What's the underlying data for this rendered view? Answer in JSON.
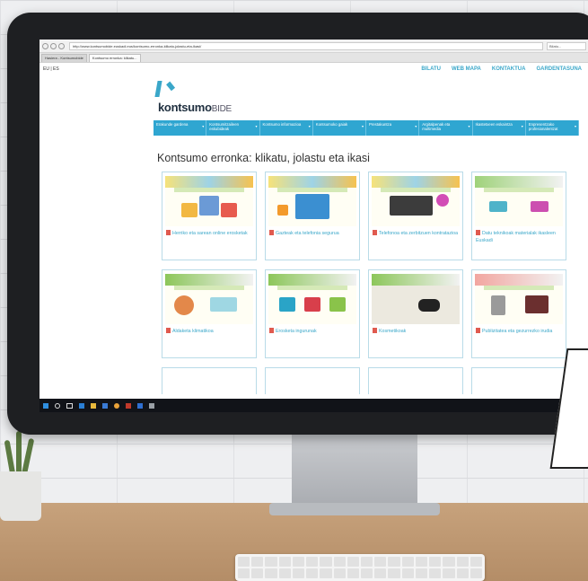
{
  "browser": {
    "address": "http://www.kontsumobide.euskadi.eus/kontsumo-erronka-klikatu-jolastu-eta-ikasi/",
    "search_placeholder": "Bilatu...",
    "tabs": [
      {
        "label": "Hasiera - Kontsumobide",
        "active": false
      },
      {
        "label": "Kontsumo erronka: klikatu...",
        "active": true
      }
    ]
  },
  "site": {
    "lang": "EU | ES",
    "topnav": [
      "BILATU",
      "WEB MAPA",
      "KONTAKTUA",
      "GARDENTASUNA"
    ],
    "logo_bold": "kontsumo",
    "logo_light": "BIDE",
    "menu": [
      "Erakunde gardena",
      "Kontsumitzaileen eskubideak",
      "Kontsumo informazioa",
      "Kontsumoko gaiak",
      "Prestakuntza",
      "Argitalpenak eta multimedia",
      "Ikastetxeen eskaintza",
      "Enpresentzako profesionalentzat"
    ],
    "heading": "Kontsumo erronka: klikatu, jolastu eta ikasi",
    "cards": [
      {
        "label": "Herriko eta sarean online erosketak"
      },
      {
        "label": "Gazteak eta telefonia segurua"
      },
      {
        "label": "Telefonoa eta zerbitzuen kontratazioa"
      },
      {
        "label": "Datu teknikoak materialak ikasleen Euskadi"
      },
      {
        "label": "Aldaketa klimatikoa"
      },
      {
        "label": "Erosketa ingurunak"
      },
      {
        "label": "Kosmetikoak"
      },
      {
        "label": "Publizitatea eta gezurrezko irudia"
      }
    ]
  },
  "colors": {
    "accent": "#2fa6d1",
    "link": "#3aa7c9",
    "bezel": "#1e1f22"
  },
  "taskbar_icons": [
    "windows-icon",
    "search-icon",
    "task-view-icon",
    "edge-icon",
    "folder-icon",
    "store-icon",
    "chrome-icon",
    "media-icon",
    "mail-icon",
    "app-icon"
  ]
}
